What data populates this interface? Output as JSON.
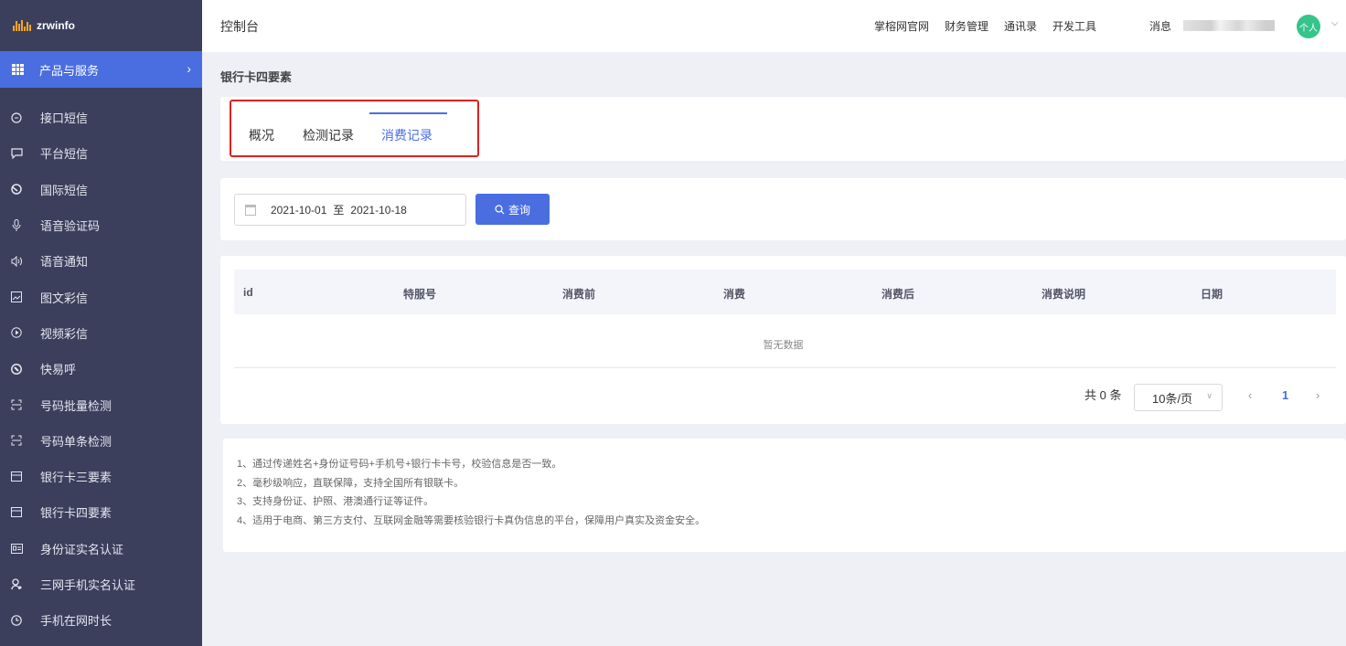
{
  "app": {
    "brand": "zrwinfo",
    "header_title": "控制台"
  },
  "sidebar": {
    "product_label": "产品与服务",
    "items": [
      {
        "label": "接口短信",
        "icon": "chat-icon"
      },
      {
        "label": "平台短信",
        "icon": "message-icon"
      },
      {
        "label": "国际短信",
        "icon": "globe-icon"
      },
      {
        "label": "语音验证码",
        "icon": "mic-icon"
      },
      {
        "label": "语音通知",
        "icon": "speaker-icon"
      },
      {
        "label": "图文彩信",
        "icon": "image-icon"
      },
      {
        "label": "视频彩信",
        "icon": "play-icon"
      },
      {
        "label": "快易呼",
        "icon": "call-icon"
      },
      {
        "label": "号码批量检测",
        "icon": "scan-icon"
      },
      {
        "label": "号码单条检测",
        "icon": "scan-icon"
      },
      {
        "label": "银行卡三要素",
        "icon": "card-icon"
      },
      {
        "label": "银行卡四要素",
        "icon": "card-icon"
      },
      {
        "label": "身份证实名认证",
        "icon": "id-card-icon"
      },
      {
        "label": "三网手机实名认证",
        "icon": "user-icon"
      },
      {
        "label": "手机在网时长",
        "icon": "clock-icon"
      }
    ]
  },
  "topnav": {
    "links": [
      "掌榕网官网",
      "财务管理",
      "通讯录",
      "开发工具"
    ],
    "messages": "消息",
    "avatar": "个人"
  },
  "page": {
    "heading": "银行卡四要素"
  },
  "tabs": [
    "概况",
    "检测记录",
    "消费记录"
  ],
  "filter": {
    "start_date": "2021-10-01",
    "separator": "至",
    "end_date": "2021-10-18",
    "query_label": "查询"
  },
  "table": {
    "columns": [
      "id",
      "特服号",
      "消费前",
      "消费",
      "消费后",
      "消费说明",
      "日期"
    ],
    "empty_text": "暂无数据"
  },
  "pagination": {
    "total": "共 0 条",
    "page_size": "10条/页",
    "current_page": "1"
  },
  "notes": [
    "1、通过传递姓名+身份证号码+手机号+银行卡卡号，校验信息是否一致。",
    "2、毫秒级响应，直联保障，支持全国所有银联卡。",
    "3、支持身份证、护照、港澳通行证等证件。",
    "4、适用于电商、第三方支付、互联网金融等需要核验银行卡真伪信息的平台，保障用户真实及资金安全。"
  ]
}
